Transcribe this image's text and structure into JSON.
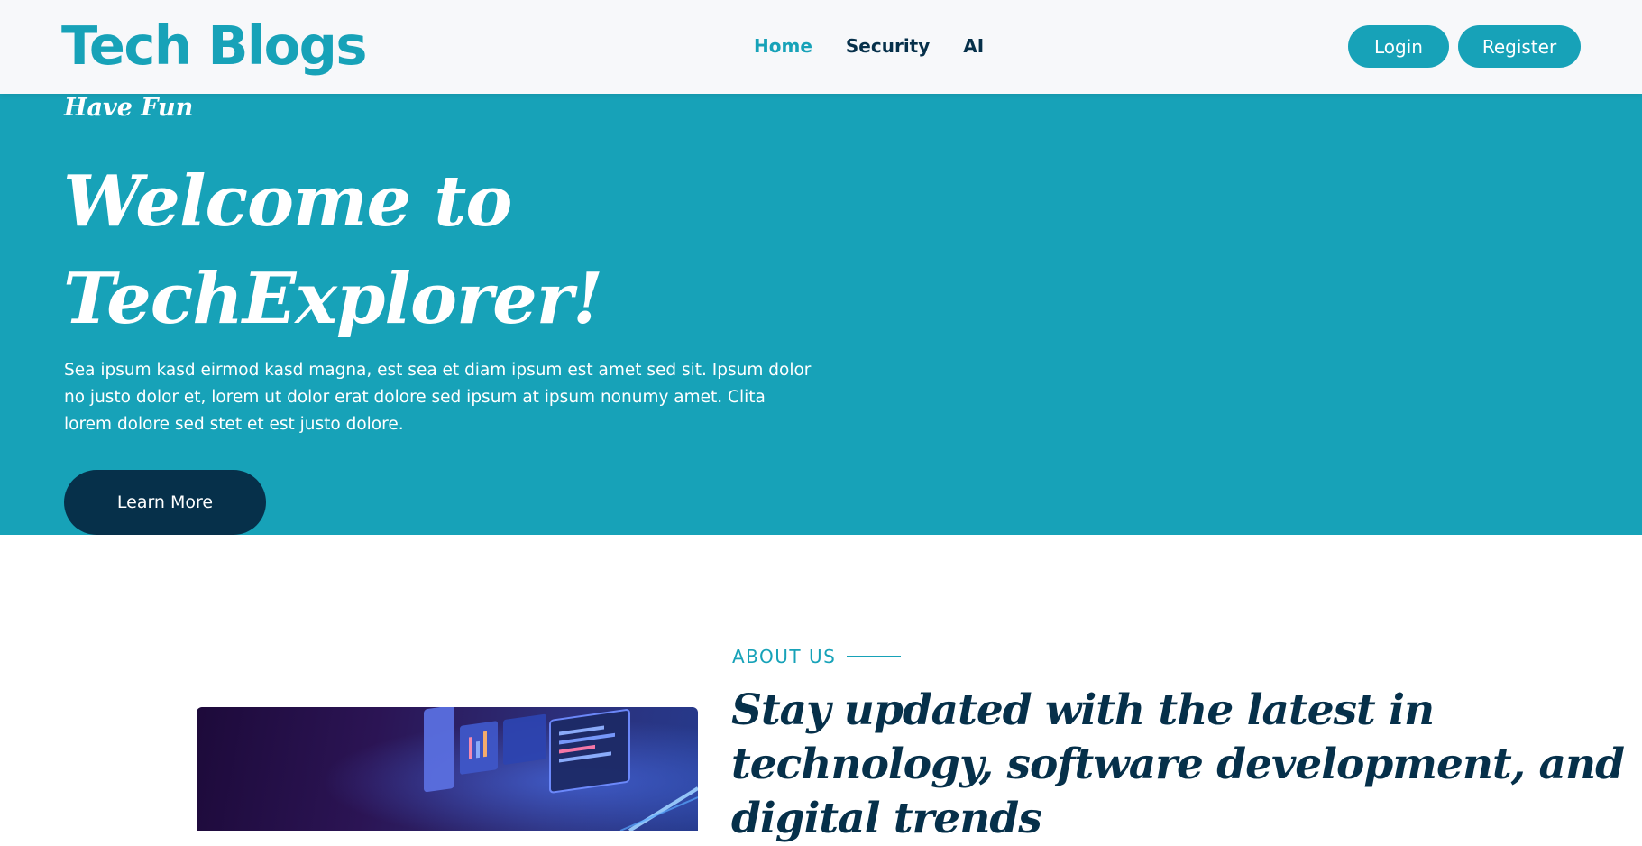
{
  "navbar": {
    "brand": "Tech Blogs",
    "links": [
      {
        "label": "Home",
        "active": true
      },
      {
        "label": "Security",
        "active": false
      },
      {
        "label": "AI",
        "active": false
      }
    ],
    "login_label": "Login",
    "register_label": "Register"
  },
  "hero": {
    "kicker": "Have Fun",
    "title": "Welcome to TechExplorer!",
    "text": "Sea ipsum kasd eirmod kasd magna, est sea et diam ipsum est amet sed sit. Ipsum dolor no justo dolor et, lorem ut dolor erat dolore sed ipsum at ipsum nonumy amet. Clita lorem dolore sed stet et est justo dolore.",
    "button_label": "Learn More"
  },
  "about": {
    "kicker": "ABOUT US",
    "heading": "Stay updated with the latest in technology, software development, and digital trends"
  },
  "colors": {
    "accent": "#17a2b8",
    "dark": "#06304a",
    "navbar_bg": "#f7f8fa"
  }
}
